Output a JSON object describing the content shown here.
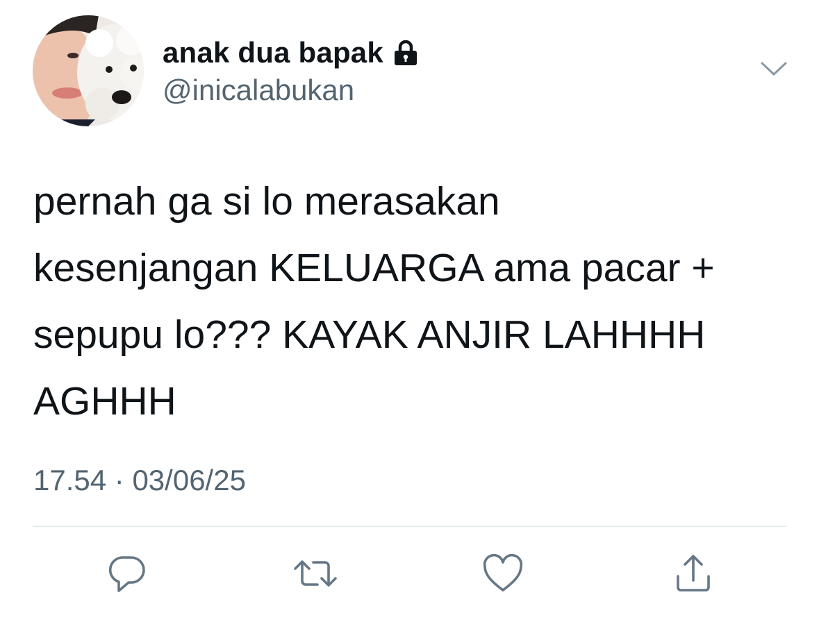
{
  "tweet": {
    "display_name": "anak dua bapak",
    "handle": "@inicalabukan",
    "protected_icon": "lock-icon",
    "more_icon": "chevron-down-icon",
    "text": "pernah ga si lo merasakan\nkesenjangan KELUARGA ama pacar +\nsepupu lo??? KAYAK ANJIR LAHHHH\nAGHHH",
    "time": "17.54",
    "separator": "·",
    "date": "03/06/25"
  },
  "actions": [
    {
      "name": "reply",
      "icon": "reply-icon"
    },
    {
      "name": "retweet",
      "icon": "retweet-icon"
    },
    {
      "name": "like",
      "icon": "heart-icon"
    },
    {
      "name": "share",
      "icon": "share-icon"
    }
  ],
  "colors": {
    "text_primary": "#0f1419",
    "text_secondary": "#536471",
    "icon_gray": "#657786",
    "divider": "#e6ecf0",
    "background": "#ffffff"
  }
}
